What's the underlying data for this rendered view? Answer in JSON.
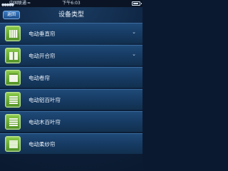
{
  "status_bar": {
    "carrier": "中国联通",
    "signal": "●●●●●",
    "wifi": "≈",
    "time": "下午6:03"
  },
  "header": {
    "back_label": "返回",
    "title": "设备类型"
  },
  "devices": [
    {
      "label": "电动垂直帘",
      "icon": "vertical-blind-icon",
      "expandable": true
    },
    {
      "label": "电动开合帘",
      "icon": "split-curtain-icon",
      "expandable": true
    },
    {
      "label": "电动卷帘",
      "icon": "roller-blind-icon",
      "expandable": false
    },
    {
      "label": "电动铝百叶帘",
      "icon": "aluminum-venetian-icon",
      "expandable": false
    },
    {
      "label": "电动木百叶帘",
      "icon": "wooden-venetian-icon",
      "expandable": false
    },
    {
      "label": "电动柔纱帘",
      "icon": "sheer-curtain-icon",
      "expandable": false
    }
  ],
  "chevron_glyph": "⌄",
  "colors": {
    "accent_green": "#6aa33a",
    "list_blue": "#1f4a78",
    "background": "#0a1a30"
  }
}
